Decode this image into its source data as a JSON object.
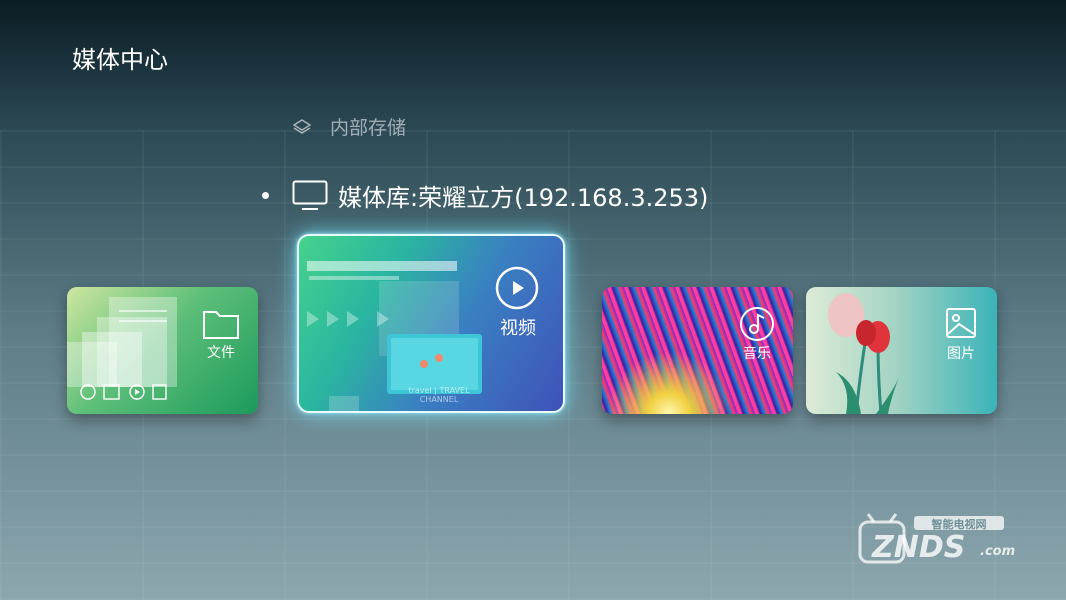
{
  "page": {
    "title": "媒体中心"
  },
  "sources": {
    "internal_storage": "内部存储",
    "media_library": "媒体库:荣耀立方(192.168.3.253)"
  },
  "categories": [
    {
      "label": "文件"
    },
    {
      "label": "视频"
    },
    {
      "label": "音乐"
    },
    {
      "label": "图片"
    }
  ],
  "video_preview_text": "travel | TRAVEL CHANNEL",
  "watermark": {
    "top": "智能电视网",
    "brand": "ZNDS",
    "suffix": ".com"
  },
  "colors": {
    "focus_glow": "#78e6ff",
    "files_card": "#1c9a5b",
    "video_card": "#3f52b8",
    "pictures_card": "#3bb3b8"
  }
}
